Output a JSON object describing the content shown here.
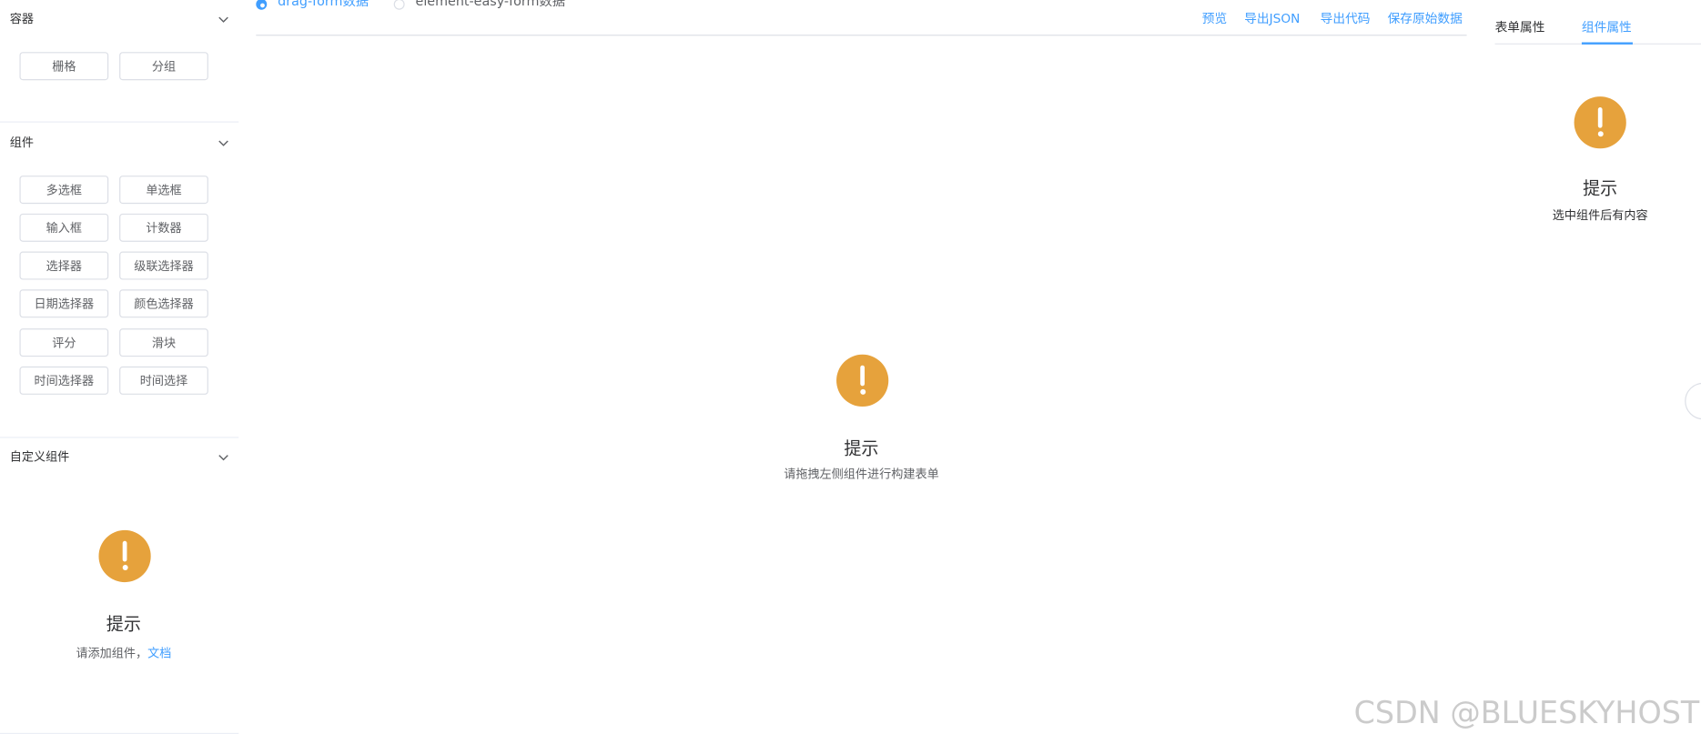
{
  "left_panel": {
    "sections": [
      {
        "title": "容器",
        "items": [
          "栅格",
          "分组"
        ]
      },
      {
        "title": "组件",
        "items": [
          "多选框",
          "单选框",
          "输入框",
          "计数器",
          "选择器",
          "级联选择器",
          "日期选择器",
          "颜色选择器",
          "评分",
          "滑块",
          "时间选择器",
          "时间选择"
        ]
      },
      {
        "title": "自定义组件"
      }
    ],
    "custom_empty": {
      "title": "提示",
      "text": "请添加组件，",
      "link": "文档"
    }
  },
  "toolbar": {
    "radios": [
      {
        "label": "drag-form数据",
        "selected": true
      },
      {
        "label": "element-easy-form数据",
        "selected": false
      }
    ],
    "actions": [
      "预览",
      "导出JSON",
      "导出代码",
      "保存原始数据"
    ]
  },
  "canvas_empty": {
    "title": "提示",
    "text": "请拖拽左侧组件进行构建表单"
  },
  "right_panel": {
    "tabs": [
      {
        "label": "表单属性",
        "active": false
      },
      {
        "label": "组件属性",
        "active": true
      }
    ],
    "empty": {
      "title": "提示",
      "text": "选中组件后有内容"
    }
  },
  "watermark": "CSDN @BLUESKYHOST",
  "colors": {
    "primary": "#409eff",
    "warning": "#e6a23c",
    "border": "#dcdfe6",
    "divider": "#ebeef5"
  },
  "icons": {
    "chevron": "chevron-down-icon",
    "warning": "exclamation-circle-icon"
  }
}
